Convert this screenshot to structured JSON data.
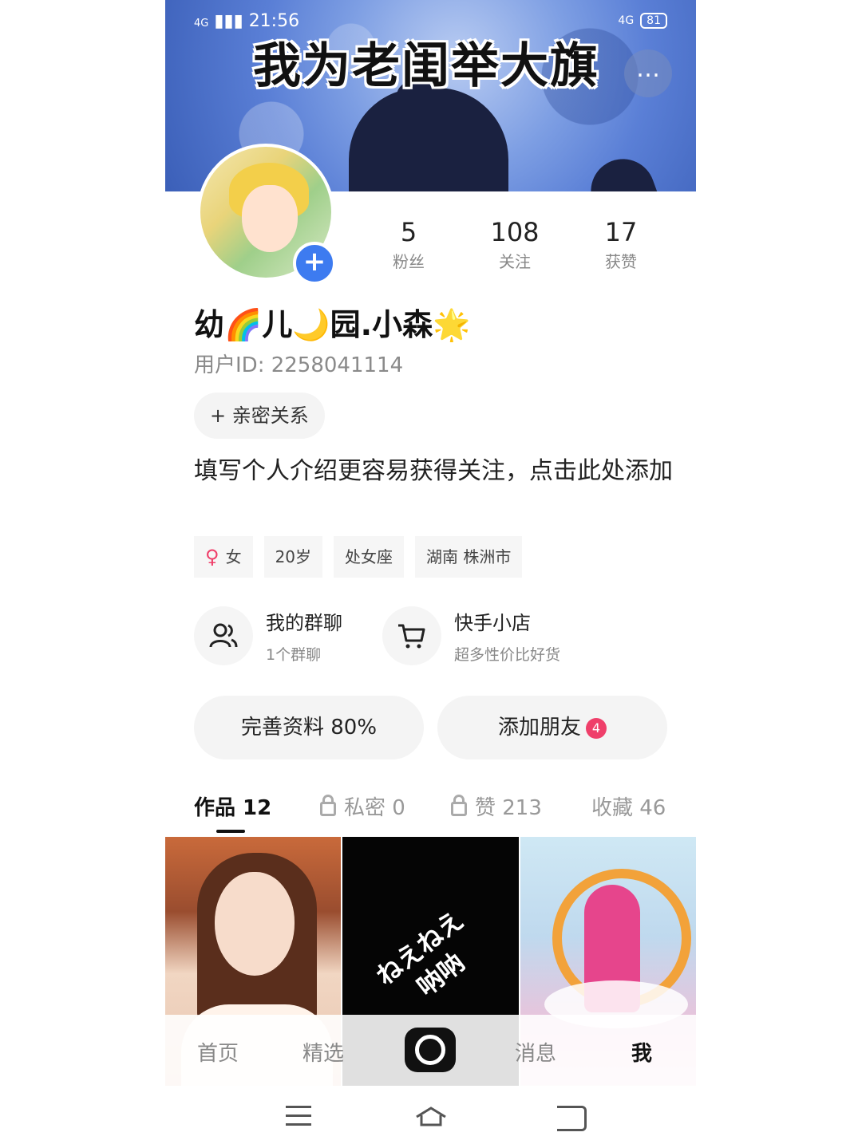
{
  "status_bar": {
    "network": "4G",
    "time": "21:56",
    "right_network": "4G",
    "battery": "81"
  },
  "banner": {
    "title": "我为老闺举大旗",
    "more_label": "…"
  },
  "profile": {
    "name": "幼🌈儿🌙园.小森🌟",
    "user_id": "用户ID: 2258041114",
    "stats": [
      {
        "value": "5",
        "label": "粉丝"
      },
      {
        "value": "108",
        "label": "关注"
      },
      {
        "value": "17",
        "label": "获赞"
      }
    ],
    "avatar_add": "+",
    "intimate_button": "+ 亲密关系",
    "intro": "填写个人介绍更容易获得关注，点击此处添加",
    "tags": {
      "gender": "女",
      "age": "20岁",
      "zodiac": "处女座",
      "location": "湖南 株洲市"
    }
  },
  "entries": {
    "group_chat": {
      "title": "我的群聊",
      "subtitle": "1个群聊"
    },
    "shop": {
      "title": "快手小店",
      "subtitle": "超多性价比好货"
    }
  },
  "actions": {
    "complete_profile": "完善资料 80%",
    "add_friends": "添加朋友",
    "add_friends_badge": "4"
  },
  "tabs": [
    {
      "label": "作品 12"
    },
    {
      "label": "私密 0"
    },
    {
      "label": "赞 213"
    },
    {
      "label": "收藏 46"
    }
  ],
  "grid": {
    "cell2_text_line1": "ねえねえ",
    "cell2_text_line2": "呐呐"
  },
  "bottom_nav": {
    "home": "首页",
    "featured": "精选",
    "messages": "消息",
    "me": "我"
  },
  "colors": {
    "accent_blue": "#3d7bf0",
    "badge_red": "#ef3f6a"
  }
}
